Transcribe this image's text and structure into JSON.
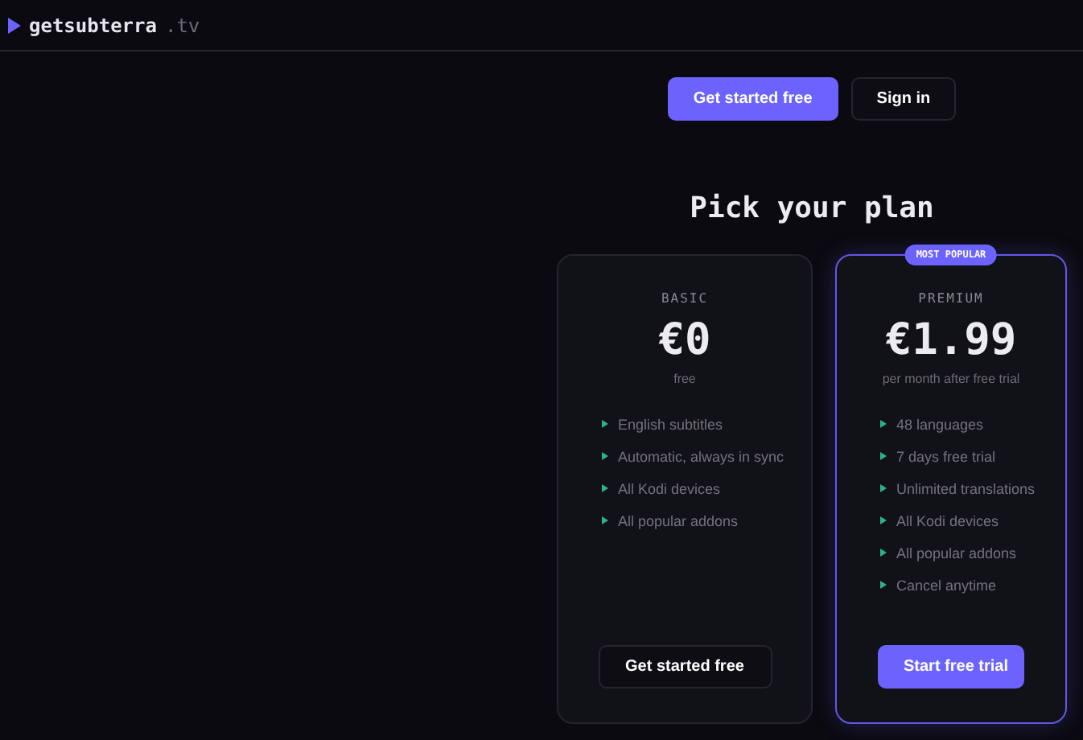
{
  "header": {
    "logo": "getsubterra",
    "domain": ".tv"
  },
  "actions": [
    {
      "label": "Get started free",
      "kind": "primary"
    },
    {
      "label": "Sign in",
      "kind": "secondary"
    }
  ],
  "title": "Pick your plan",
  "plans": [
    {
      "name": "BASIC",
      "price": "€0",
      "period": "free",
      "featured": false,
      "features": [
        "English subtitles",
        "Automatic, always in sync",
        "All Kodi devices",
        "All popular addons"
      ],
      "button": {
        "label": "Get started free",
        "kind": "secondary"
      }
    },
    {
      "name": "PREMIUM",
      "badge": "MOST POPULAR",
      "price": "€1.99",
      "period": "per month after free trial",
      "featured": true,
      "features": [
        "48 languages",
        "7 days free trial",
        "Unlimited translations",
        "All Kodi devices",
        "All popular addons",
        "Cancel anytime"
      ],
      "button": {
        "label": "Start free trial",
        "kind": "primary"
      }
    }
  ]
}
